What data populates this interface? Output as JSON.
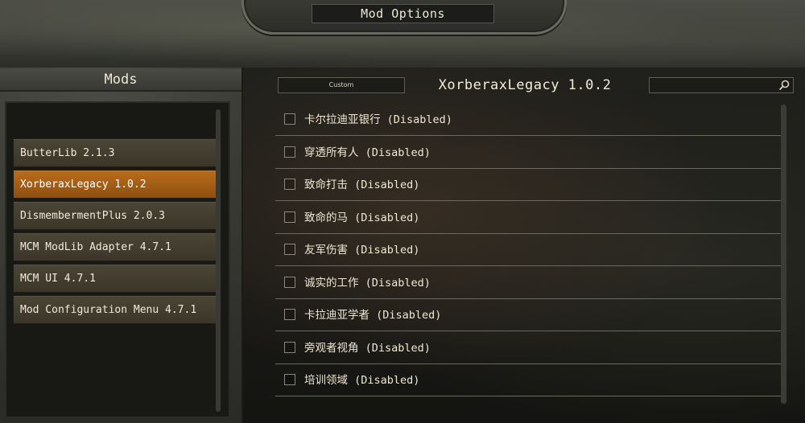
{
  "header": {
    "title": "Mod Options"
  },
  "left_panel": {
    "title": "Mods",
    "mods": [
      {
        "label": "ButterLib 2.1.3",
        "selected": false
      },
      {
        "label": "XorberaxLegacy 1.0.2",
        "selected": true
      },
      {
        "label": "DismembermentPlus 2.0.3",
        "selected": false
      },
      {
        "label": "MCM ModLib Adapter 4.7.1",
        "selected": false
      },
      {
        "label": "MCM UI 4.7.1",
        "selected": false
      },
      {
        "label": "Mod Configuration Menu 4.7.1",
        "selected": false
      }
    ]
  },
  "right_panel": {
    "preset_button": "Custom",
    "mod_title": "XorberaxLegacy 1.0.2",
    "search": {
      "placeholder": "",
      "icon": "search-icon"
    },
    "options": [
      {
        "label": "卡尔拉迪亚银行 (Disabled)",
        "checked": false
      },
      {
        "label": "穿透所有人 (Disabled)",
        "checked": false
      },
      {
        "label": "致命打击 (Disabled)",
        "checked": false
      },
      {
        "label": "致命的马 (Disabled)",
        "checked": false
      },
      {
        "label": "友军伤害 (Disabled)",
        "checked": false
      },
      {
        "label": "诚实的工作 (Disabled)",
        "checked": false
      },
      {
        "label": "卡拉迪亚学者 (Disabled)",
        "checked": false
      },
      {
        "label": "旁观者视角 (Disabled)",
        "checked": false
      },
      {
        "label": "培训领域 (Disabled)",
        "checked": false
      }
    ]
  },
  "colors": {
    "accent": "#b86d1c",
    "text": "#e8e0cf"
  }
}
